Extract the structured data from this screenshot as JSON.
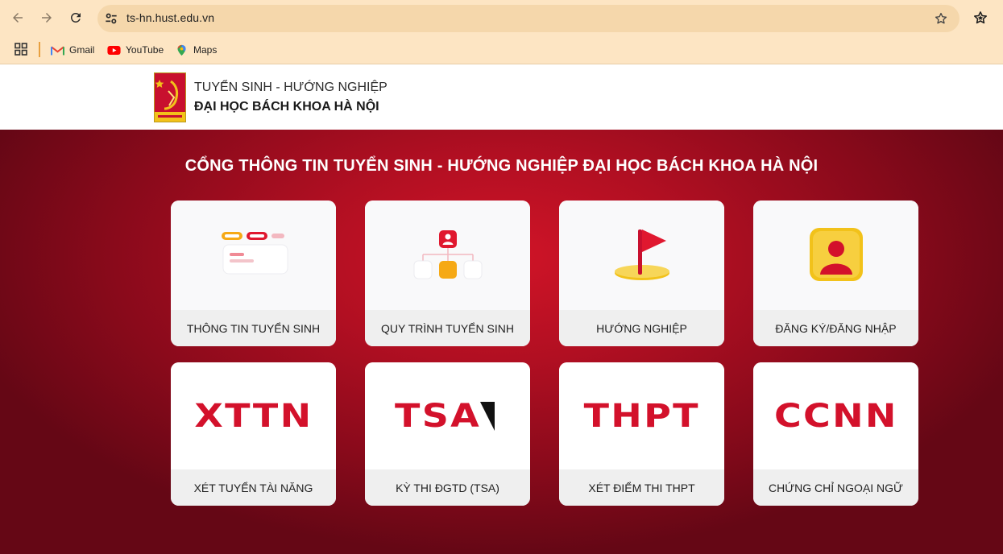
{
  "browser": {
    "url": "ts-hn.hust.edu.vn",
    "bookmarks": [
      {
        "label": "Gmail",
        "icon": "gmail-icon"
      },
      {
        "label": "YouTube",
        "icon": "youtube-icon"
      },
      {
        "label": "Maps",
        "icon": "maps-icon"
      }
    ]
  },
  "header": {
    "subtitle": "TUYỂN SINH - HƯỚNG NGHIỆP",
    "title": "ĐẠI HỌC BÁCH KHOA HÀ NỘI"
  },
  "hero": {
    "title": "CỔNG THÔNG TIN TUYỂN SINH - HƯỚNG NGHIỆP ĐẠI HỌC BÁCH KHOA HÀ NỘI"
  },
  "cards": [
    {
      "label": "THÔNG TIN TUYỂN SINH",
      "icon": "info-panel-icon"
    },
    {
      "label": "QUY TRÌNH TUYỂN SINH",
      "icon": "process-tree-icon"
    },
    {
      "label": "HƯỚNG NGHIỆP",
      "icon": "flag-icon"
    },
    {
      "label": "ĐĂNG KÝ/ĐĂNG NHẬP",
      "icon": "user-badge-icon"
    },
    {
      "label": "XÉT TUYỂN TÀI NĂNG",
      "word": "XTTN"
    },
    {
      "label": "KỲ THI ĐGTD (TSA)",
      "word": "TSA"
    },
    {
      "label": "XÉT ĐIỂM THI THPT",
      "word": "THPT"
    },
    {
      "label": "CHỨNG CHỈ NGOẠI NGỮ",
      "word": "CCNN"
    }
  ],
  "colors": {
    "brand_red": "#c8102e",
    "chrome_bg": "#fde5c3",
    "omnibox_bg": "#f5d7ab"
  }
}
